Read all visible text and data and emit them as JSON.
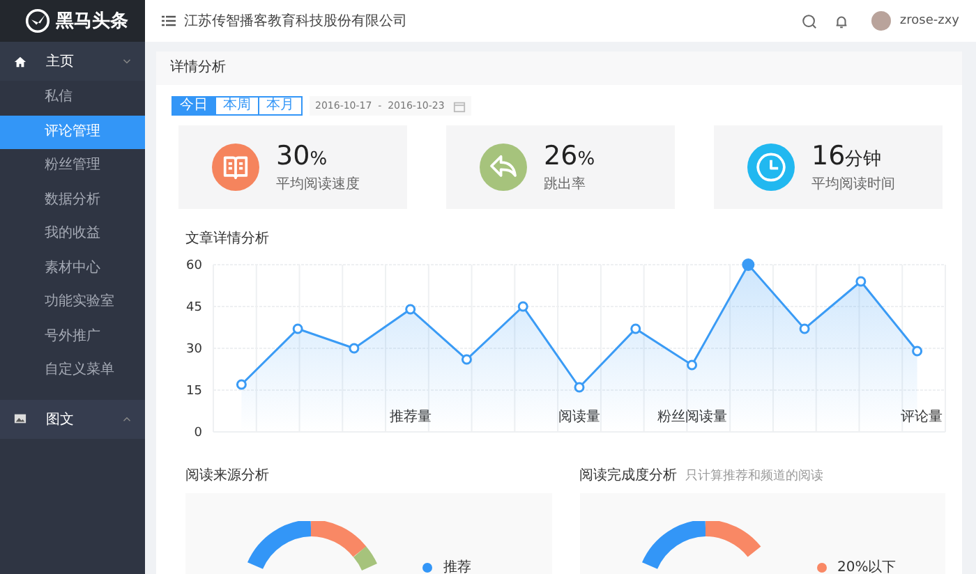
{
  "logo": {
    "text": "黑马头条"
  },
  "sidebar": {
    "items": [
      {
        "label": "主页",
        "expanded": true,
        "children": [
          {
            "label": "私信",
            "selected": false
          },
          {
            "label": "评论管理",
            "selected": true
          },
          {
            "label": "粉丝管理",
            "selected": false
          },
          {
            "label": "数据分析",
            "selected": false
          },
          {
            "label": "我的收益",
            "selected": false
          },
          {
            "label": "素材中心",
            "selected": false
          },
          {
            "label": "功能实验室",
            "selected": false
          },
          {
            "label": "号外推广",
            "selected": false
          },
          {
            "label": "自定义菜单",
            "selected": false
          }
        ]
      },
      {
        "label": "图文",
        "expanded": false
      }
    ]
  },
  "header": {
    "company": "江苏传智播客教育科技股份有限公司",
    "user": "zrose-zxy"
  },
  "panel": {
    "title": "详情分析",
    "tabs": [
      {
        "label": "今日",
        "selected": true
      },
      {
        "label": "本周",
        "selected": false
      },
      {
        "label": "本月",
        "selected": false
      }
    ],
    "date_range": "2016-10-17  -  2016-10-23",
    "stats": [
      {
        "value": "30",
        "unit": "%",
        "label": "平均阅读速度",
        "color": "#f5845d"
      },
      {
        "value": "26",
        "unit": "%",
        "label": "跳出率",
        "color": "#a6c37c"
      },
      {
        "value": "16",
        "unit": "分钟",
        "label": "平均阅读时间",
        "color": "#21b8f0"
      }
    ],
    "trend": {
      "title": "文章详情分析",
      "chart_data": {
        "type": "area",
        "categories": [
          null,
          null,
          null,
          "推荐量",
          null,
          null,
          "阅读量",
          null,
          "粉丝阅读量",
          null,
          null,
          null,
          "评论量"
        ],
        "series": [
          {
            "color": "#3a9bf5",
            "values": [
              17,
              37,
              30,
              44,
              26,
              45,
              16,
              37,
              24,
              60,
              37,
              54,
              29
            ]
          }
        ],
        "ylim": [
          0,
          60
        ],
        "yticks": [
          0,
          15,
          30,
          45,
          60
        ],
        "grid": true
      }
    },
    "sources": {
      "title": "阅读来源分析",
      "legend": [
        {
          "label": "推荐",
          "color": "#3396f7"
        }
      ]
    },
    "completion": {
      "title": "阅读完成度分析",
      "note": "只计算推荐和频道的阅读",
      "legend": [
        {
          "label": "20%以下",
          "color": "#f98865"
        }
      ]
    }
  }
}
